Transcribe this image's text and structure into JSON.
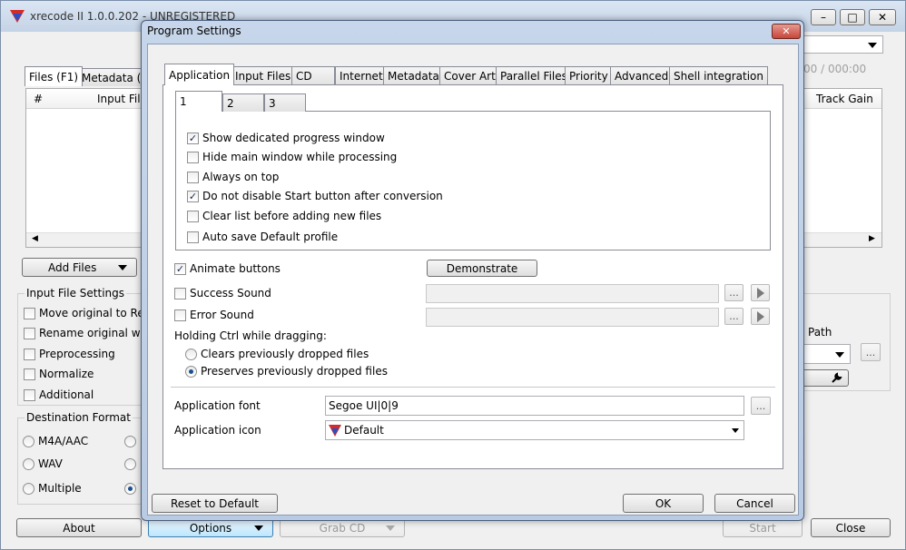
{
  "main": {
    "title": "xrecode II 1.0.0.202 - UNREGISTERED",
    "tabs": [
      "Files (F1)",
      "Metadata (F2"
    ],
    "columns": [
      "#",
      "Input File"
    ],
    "right_col": "Track Gain",
    "counter": "00 / 000:00",
    "add_files": "Add Files",
    "input_settings_title": "Input File Settings",
    "input_settings": [
      "Move original to Recy",
      "Rename original when",
      "Preprocessing",
      "Normalize",
      "Additional"
    ],
    "dest_title": "Destination Format",
    "dest": [
      "M4A/AAC",
      "WAV",
      "Multiple"
    ],
    "path_label": "Path",
    "buttons": {
      "about": "About",
      "options": "Options",
      "grab": "Grab CD",
      "start": "Start",
      "close": "Close"
    }
  },
  "dialog": {
    "title": "Program Settings",
    "tabs": [
      "Application",
      "Input Files",
      "CD",
      "Internet",
      "Metadata",
      "Cover Art",
      "Parallel Files",
      "Priority",
      "Advanced",
      "Shell integration"
    ],
    "subtabs": [
      "1",
      "2",
      "3"
    ],
    "options": [
      {
        "label": "Show dedicated progress window",
        "checked": true
      },
      {
        "label": "Hide main window while processing",
        "checked": false
      },
      {
        "label": "Always on top",
        "checked": false
      },
      {
        "label": "Do not disable Start button after conversion",
        "checked": true
      },
      {
        "label": "Clear list before adding new files",
        "checked": false
      },
      {
        "label": "Auto save Default profile",
        "checked": false
      }
    ],
    "animate_buttons": "Animate buttons",
    "demonstrate": "Demonstrate",
    "success_sound": "Success Sound",
    "error_sound": "Error Sound",
    "ctrl_label": "Holding Ctrl while dragging:",
    "radio_clear": "Clears previously dropped files",
    "radio_preserve": "Preserves previously dropped files",
    "font_label": "Application font",
    "font_value": "Segoe UI|0|9",
    "icon_label": "Application icon",
    "icon_value": "Default",
    "ellipsis": "...",
    "reset": "Reset to Default",
    "ok": "OK",
    "cancel": "Cancel",
    "check_mark": "✓"
  },
  "colors": {
    "accent": "#1b4f8f",
    "close_red": "#c8453a"
  }
}
